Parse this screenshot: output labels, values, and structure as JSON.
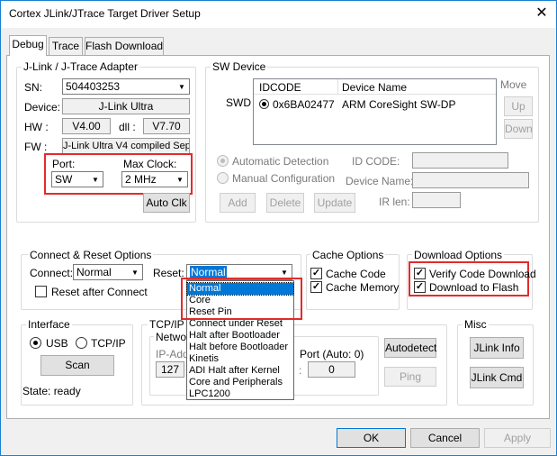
{
  "window": {
    "title": "Cortex JLink/JTrace Target Driver Setup",
    "close_glyph": "✕"
  },
  "tabs": [
    {
      "label": "Debug"
    },
    {
      "label": "Trace"
    },
    {
      "label": "Flash Download"
    }
  ],
  "adapter": {
    "legend": "J-Link / J-Trace Adapter",
    "sn_label": "SN:",
    "sn_value": "504403253",
    "device_label": "Device:",
    "device_value": "J-Link Ultra",
    "hw_label": "HW :",
    "hw_value": "V4.00",
    "dll_label": "dll :",
    "dll_value": "V7.70",
    "fw_label": "FW :",
    "fw_value": "J-Link Ultra V4 compiled Sep",
    "port_label": "Port:",
    "port_value": "SW",
    "max_clock_label": "Max Clock:",
    "max_clock_value": "2 MHz",
    "auto_clk": "Auto Clk"
  },
  "sw_device": {
    "legend": "SW Device",
    "swd_label": "SWD",
    "col_idcode": "IDCODE",
    "col_device": "Device Name",
    "row_idcode": "0x6BA02477",
    "row_device": "ARM CoreSight SW-DP",
    "move_label": "Move",
    "up": "Up",
    "down": "Down",
    "auto_detect": "Automatic Detection",
    "manual_config": "Manual Configuration",
    "id_code_label": "ID CODE:",
    "device_name_label": "Device Name:",
    "ir_len_label": "IR len:",
    "add": "Add",
    "delete": "Delete",
    "update": "Update"
  },
  "connect_reset": {
    "legend": "Connect & Reset Options",
    "connect_label": "Connect:",
    "connect_value": "Normal",
    "reset_label": "Reset:",
    "reset_value": "Normal",
    "reset_after_connect": "Reset after Connect",
    "reset_options": [
      "Normal",
      "Core",
      "Reset Pin",
      "Connect under Reset",
      "Halt after Bootloader",
      "Halt before Bootloader",
      "Kinetis",
      "ADI Halt after Kernel",
      "Core and Peripherals",
      "LPC1200"
    ]
  },
  "cache": {
    "legend": "Cache Options",
    "cache_code": "Cache Code",
    "cache_code_checked": true,
    "cache_memory": "Cache Memory",
    "cache_memory_checked": true
  },
  "download": {
    "legend": "Download Options",
    "verify": "Verify Code Download",
    "verify_checked": true,
    "to_flash": "Download to Flash",
    "to_flash_checked": true
  },
  "interface": {
    "legend": "Interface",
    "usb": "USB",
    "tcpip": "TCP/IP",
    "scan": "Scan",
    "state": "State: ready"
  },
  "tcpip": {
    "legend": "TCP/IP",
    "network_legend": "Network",
    "ip_address_label": "IP-Address",
    "ip_first_octet": "127",
    "port_label": "Port (Auto: 0)",
    "port_colon": ":",
    "port_value": "0",
    "autodetect": "Autodetect",
    "ping": "Ping"
  },
  "misc": {
    "legend": "Misc",
    "jlink_info": "JLink Info",
    "jlink_cmd": "JLink Cmd"
  },
  "footer": {
    "ok": "OK",
    "cancel": "Cancel",
    "apply": "Apply"
  },
  "colors": {
    "highlight": "#e32b2b",
    "selection": "#0078d7",
    "window_border": "#1a7fd4"
  }
}
